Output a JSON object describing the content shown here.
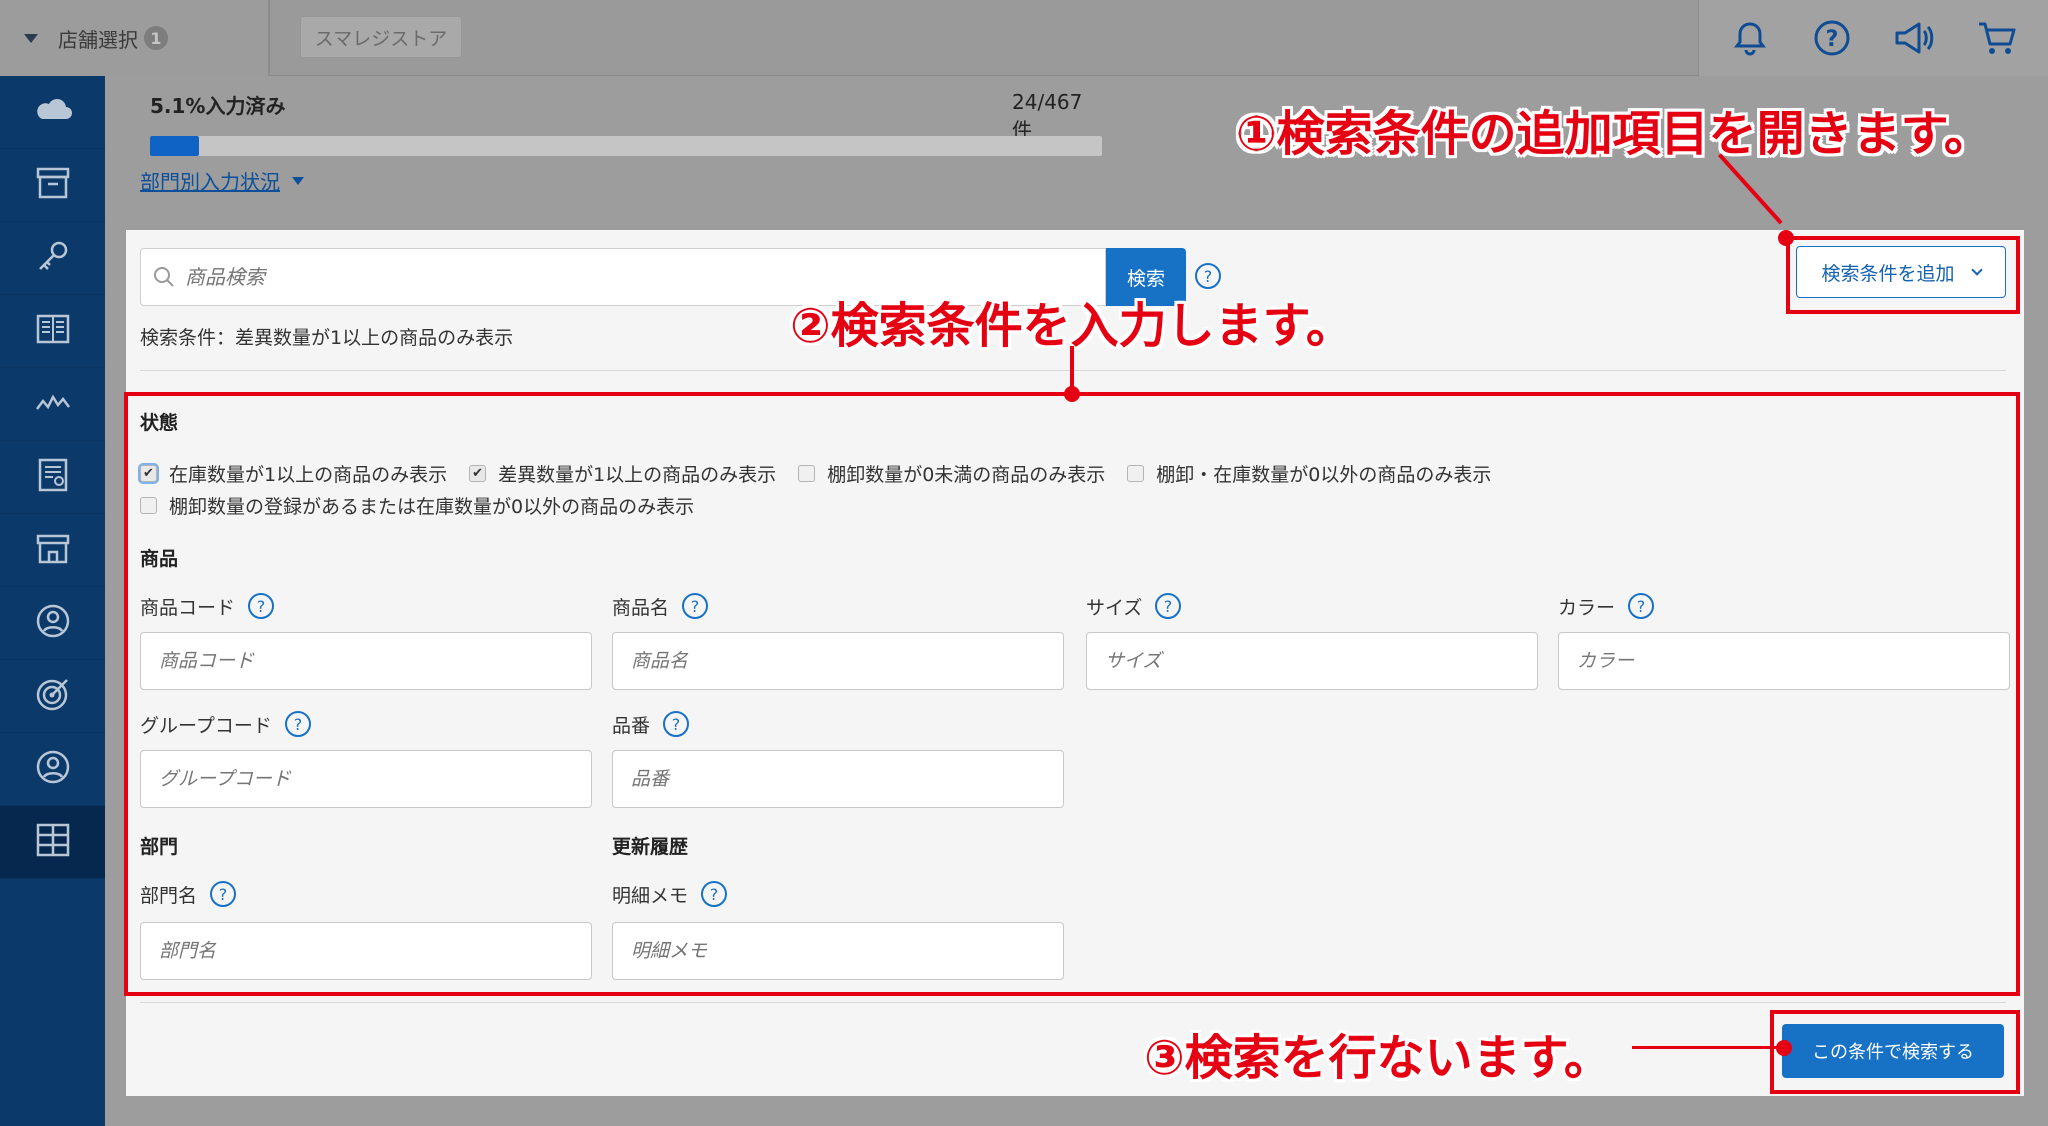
{
  "topbar": {
    "store_select_label": "店舗選択",
    "store_badge": "1",
    "store_name": "スマレジストア",
    "icons": [
      "bell-icon",
      "help-icon",
      "megaphone-icon",
      "cart-icon"
    ]
  },
  "sidebar": {
    "items": [
      "cloud-icon",
      "archive-icon",
      "key-icon",
      "ledger-icon",
      "chart-icon",
      "report-icon",
      "store-icon",
      "customer-icon",
      "target-icon",
      "user-icon",
      "grid-icon"
    ],
    "active_index": 10
  },
  "progress": {
    "percent_text": "5.1%入力済み",
    "count_text": "24/467件",
    "fraction": 0.051,
    "dept_status_link": "部門別入力状況"
  },
  "search": {
    "placeholder": "商品検索",
    "button_label": "検索",
    "condition_text": "検索条件：差異数量が1以上の商品のみ表示",
    "add_condition_label": "検索条件を追加"
  },
  "status_section": {
    "title": "状態",
    "checkboxes": [
      {
        "label": "在庫数量が1以上の商品のみ表示",
        "checked": true
      },
      {
        "label": "差異数量が1以上の商品のみ表示",
        "checked": true
      },
      {
        "label": "棚卸数量が0未満の商品のみ表示",
        "checked": false
      },
      {
        "label": "棚卸・在庫数量が0以外の商品のみ表示",
        "checked": false
      },
      {
        "label": "棚卸数量の登録があるまたは在庫数量が0以外の商品のみ表示",
        "checked": false
      }
    ]
  },
  "product_section": {
    "title": "商品",
    "fields": [
      {
        "label": "商品コード",
        "placeholder": "商品コード"
      },
      {
        "label": "商品名",
        "placeholder": "商品名"
      },
      {
        "label": "サイズ",
        "placeholder": "サイズ"
      },
      {
        "label": "カラー",
        "placeholder": "カラー"
      },
      {
        "label": "グループコード",
        "placeholder": "グループコード"
      },
      {
        "label": "品番",
        "placeholder": "品番"
      }
    ]
  },
  "dept_section": {
    "title": "部門",
    "fields": [
      {
        "label": "部門名",
        "placeholder": "部門名"
      }
    ]
  },
  "history_section": {
    "title": "更新履歴",
    "fields": [
      {
        "label": "明細メモ",
        "placeholder": "明細メモ"
      }
    ]
  },
  "submit_label": "この条件で検索する",
  "annotations": {
    "step1": "①検索条件の追加項目を開きます。",
    "step2": "②検索条件を入力します。",
    "step3": "③検索を行ないます。",
    "color": "#e50012"
  }
}
